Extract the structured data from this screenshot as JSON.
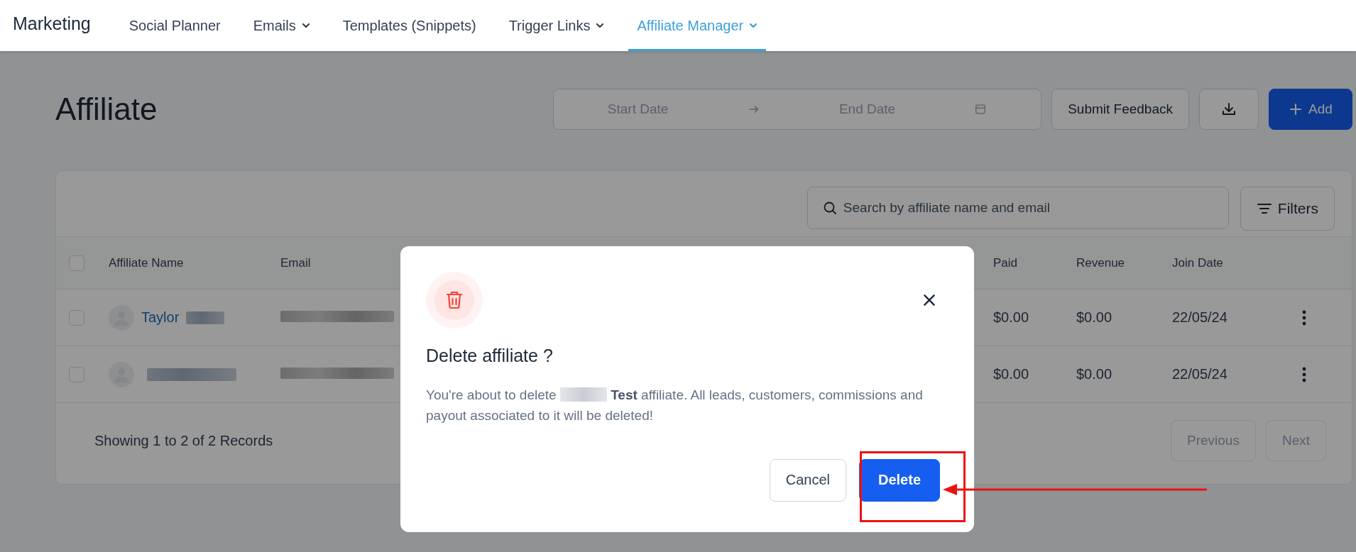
{
  "nav": {
    "title": "Marketing",
    "items": [
      {
        "label": "Social Planner",
        "dropdown": false,
        "selected": false
      },
      {
        "label": "Emails",
        "dropdown": true,
        "selected": false
      },
      {
        "label": "Templates (Snippets)",
        "dropdown": false,
        "selected": false
      },
      {
        "label": "Trigger Links",
        "dropdown": true,
        "selected": false
      },
      {
        "label": "Affiliate Manager",
        "dropdown": true,
        "selected": true
      }
    ]
  },
  "page": {
    "title": "Affiliate",
    "date_range": {
      "start_placeholder": "Start Date",
      "end_placeholder": "End Date"
    },
    "feedback_button": "Submit Feedback",
    "add_button": "Add"
  },
  "table": {
    "search_placeholder": "Search by affiliate name and email",
    "filters_button": "Filters",
    "header_checked": false,
    "columns": [
      "Affiliate Name",
      "Email",
      "Paid",
      "Revenue",
      "Join Date"
    ],
    "rows": [
      {
        "checked": false,
        "name": "Taylor",
        "paid": "$0.00",
        "revenue": "$0.00",
        "join_date": "22/05/24"
      },
      {
        "checked": false,
        "paid": "$0.00",
        "revenue": "$0.00",
        "join_date": "22/05/24"
      }
    ],
    "footer": "Showing 1 to 2 of 2 Records",
    "pager": [
      {
        "label": "Previous",
        "disabled": true
      },
      {
        "label": "Next",
        "disabled": true
      }
    ]
  },
  "dialog": {
    "title": "Delete affiliate ?",
    "message": [
      "You're about to delete",
      "**Test** affiliate. All leads, customers, commissions and payout associated to it will be deleted!"
    ],
    "cancel": "Cancel",
    "confirm": "Delete"
  }
}
